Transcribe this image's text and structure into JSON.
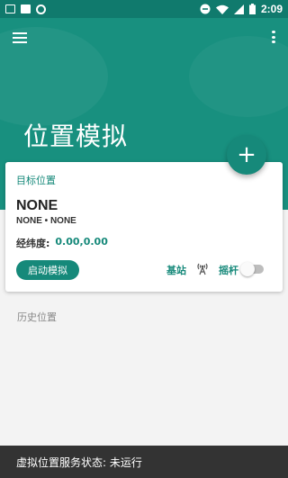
{
  "status_bar": {
    "time": "2:09",
    "icons": [
      "image-icon",
      "square-icon",
      "circle-icon",
      "minus-circle-icon",
      "wifi-icon",
      "signal-icon",
      "battery-icon"
    ]
  },
  "header": {
    "title": "位置模拟",
    "menu_icon": "hamburger-menu-icon",
    "more_icon": "more-vertical-icon",
    "color": "#18907f"
  },
  "fab": {
    "label": "+"
  },
  "target_card": {
    "title": "目标位置",
    "location_name": "NONE",
    "location_sub": "NONE • NONE",
    "coord_label": "经纬度:",
    "coord_value": "0.00,0.00",
    "start_button": "启动模拟",
    "station_label": "基站",
    "station_icon": "cell-tower-icon",
    "joystick_label": "摇杆",
    "joystick_enabled": false
  },
  "history": {
    "title": "历史位置"
  },
  "snackbar": {
    "text": "虚拟位置服务状态: 未运行"
  },
  "colors": {
    "accent": "#16897a",
    "status_bar": "#107a6d",
    "snackbar": "#333333"
  }
}
